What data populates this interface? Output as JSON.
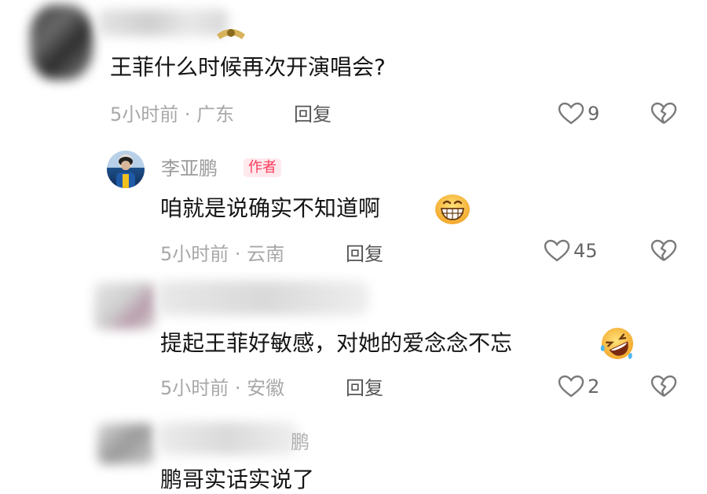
{
  "colors": {
    "text": "#151515",
    "meta": "#a8a8a8",
    "author_tag_text": "#ff3b5c",
    "author_tag_bg": "#ffe9ec",
    "icon": "#7a7a7a"
  },
  "comments": [
    {
      "text": "王菲什么时候再次开演唱会?",
      "time_location": "5小时前 · 广东",
      "reply_label": "回复",
      "likes": "9",
      "badge_icon": "gold-medal-icon"
    },
    {
      "username": "李亚鹏",
      "author_tag": "作者",
      "text": "咱就是说确实不知道啊",
      "emoji": "grinning-face-icon",
      "time_location": "5小时前 · 云南",
      "reply_label": "回复",
      "likes": "45"
    },
    {
      "text": "提起王菲好敏感，对她的爱念念不忘",
      "emoji": "rolling-laughing-face-icon",
      "time_location": "5小时前 · 安徽",
      "reply_label": "回复",
      "likes": "2"
    },
    {
      "username_partial": "鹏",
      "text": "鹏哥实话实说了"
    }
  ]
}
